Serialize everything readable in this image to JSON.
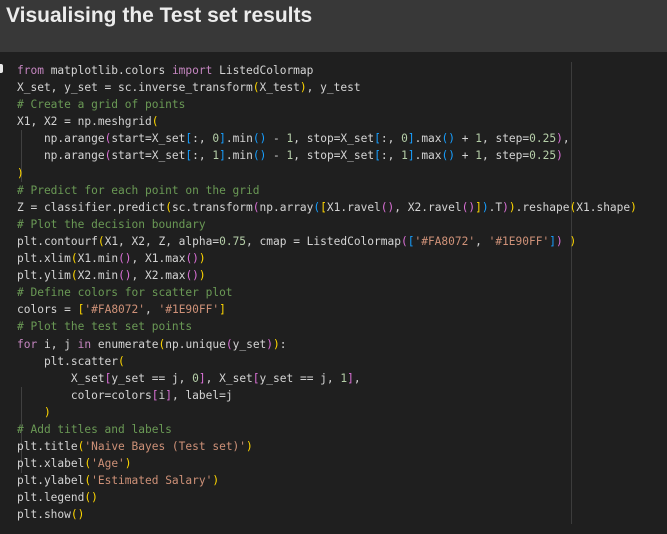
{
  "heading": "Visualising the Test set results",
  "code_lines": [
    [
      {
        "t": "from",
        "c": "kw"
      },
      {
        "t": " matplotlib.colors ",
        "c": "id"
      },
      {
        "t": "import",
        "c": "kw"
      },
      {
        "t": " ListedColormap",
        "c": "id"
      }
    ],
    [
      {
        "t": "X_set, y_set = sc.inverse_transform",
        "c": "id"
      },
      {
        "t": "(",
        "c": "p1"
      },
      {
        "t": "X_test",
        "c": "id"
      },
      {
        "t": ")",
        "c": "p1"
      },
      {
        "t": ", y_test",
        "c": "id"
      }
    ],
    [
      {
        "t": "# Create a grid of points",
        "c": "cm"
      }
    ],
    [
      {
        "t": "X1, X2 = np.meshgrid",
        "c": "id"
      },
      {
        "t": "(",
        "c": "p1"
      }
    ],
    [
      {
        "t": "    np.arange",
        "c": "id"
      },
      {
        "t": "(",
        "c": "p2"
      },
      {
        "t": "start=X_set",
        "c": "id"
      },
      {
        "t": "[",
        "c": "p3"
      },
      {
        "t": ":, ",
        "c": "id"
      },
      {
        "t": "0",
        "c": "nm"
      },
      {
        "t": "]",
        "c": "p3"
      },
      {
        "t": ".min",
        "c": "id"
      },
      {
        "t": "()",
        "c": "p3"
      },
      {
        "t": " - ",
        "c": "id"
      },
      {
        "t": "1",
        "c": "nm"
      },
      {
        "t": ", stop=X_set",
        "c": "id"
      },
      {
        "t": "[",
        "c": "p3"
      },
      {
        "t": ":, ",
        "c": "id"
      },
      {
        "t": "0",
        "c": "nm"
      },
      {
        "t": "]",
        "c": "p3"
      },
      {
        "t": ".max",
        "c": "id"
      },
      {
        "t": "()",
        "c": "p3"
      },
      {
        "t": " + ",
        "c": "id"
      },
      {
        "t": "1",
        "c": "nm"
      },
      {
        "t": ", step=",
        "c": "id"
      },
      {
        "t": "0.25",
        "c": "nm"
      },
      {
        "t": ")",
        "c": "p2"
      },
      {
        "t": ",",
        "c": "id"
      }
    ],
    [
      {
        "t": "    np.arange",
        "c": "id"
      },
      {
        "t": "(",
        "c": "p2"
      },
      {
        "t": "start=X_set",
        "c": "id"
      },
      {
        "t": "[",
        "c": "p3"
      },
      {
        "t": ":, ",
        "c": "id"
      },
      {
        "t": "1",
        "c": "nm"
      },
      {
        "t": "]",
        "c": "p3"
      },
      {
        "t": ".min",
        "c": "id"
      },
      {
        "t": "()",
        "c": "p3"
      },
      {
        "t": " - ",
        "c": "id"
      },
      {
        "t": "1",
        "c": "nm"
      },
      {
        "t": ", stop=X_set",
        "c": "id"
      },
      {
        "t": "[",
        "c": "p3"
      },
      {
        "t": ":, ",
        "c": "id"
      },
      {
        "t": "1",
        "c": "nm"
      },
      {
        "t": "]",
        "c": "p3"
      },
      {
        "t": ".max",
        "c": "id"
      },
      {
        "t": "()",
        "c": "p3"
      },
      {
        "t": " + ",
        "c": "id"
      },
      {
        "t": "1",
        "c": "nm"
      },
      {
        "t": ", step=",
        "c": "id"
      },
      {
        "t": "0.25",
        "c": "nm"
      },
      {
        "t": ")",
        "c": "p2"
      }
    ],
    [
      {
        "t": ")",
        "c": "p1"
      }
    ],
    [
      {
        "t": "# Predict for each point on the grid",
        "c": "cm"
      }
    ],
    [
      {
        "t": "Z = classifier.predict",
        "c": "id"
      },
      {
        "t": "(",
        "c": "p1"
      },
      {
        "t": "sc.transform",
        "c": "id"
      },
      {
        "t": "(",
        "c": "p2"
      },
      {
        "t": "np.array",
        "c": "id"
      },
      {
        "t": "(",
        "c": "p3"
      },
      {
        "t": "[",
        "c": "p1"
      },
      {
        "t": "X1.ravel",
        "c": "id"
      },
      {
        "t": "()",
        "c": "p2"
      },
      {
        "t": ", X2.ravel",
        "c": "id"
      },
      {
        "t": "()",
        "c": "p2"
      },
      {
        "t": "]",
        "c": "p1"
      },
      {
        "t": ")",
        "c": "p3"
      },
      {
        "t": ".T",
        "c": "id"
      },
      {
        "t": ")",
        "c": "p2"
      },
      {
        "t": ")",
        "c": "p1"
      },
      {
        "t": ".reshape",
        "c": "id"
      },
      {
        "t": "(",
        "c": "p1"
      },
      {
        "t": "X1.shape",
        "c": "id"
      },
      {
        "t": ")",
        "c": "p1"
      }
    ],
    [
      {
        "t": "# Plot the decision boundary",
        "c": "cm"
      }
    ],
    [
      {
        "t": "plt.contourf",
        "c": "id"
      },
      {
        "t": "(",
        "c": "p1"
      },
      {
        "t": "X1, X2, Z, alpha=",
        "c": "id"
      },
      {
        "t": "0.75",
        "c": "nm"
      },
      {
        "t": ", cmap = ListedColormap",
        "c": "id"
      },
      {
        "t": "(",
        "c": "p2"
      },
      {
        "t": "[",
        "c": "p3"
      },
      {
        "t": "'#FA8072'",
        "c": "st"
      },
      {
        "t": ", ",
        "c": "id"
      },
      {
        "t": "'#1E90FF'",
        "c": "st"
      },
      {
        "t": "]",
        "c": "p3"
      },
      {
        "t": ")",
        "c": "p2"
      },
      {
        "t": " ",
        "c": "id"
      },
      {
        "t": ")",
        "c": "p1"
      }
    ],
    [
      {
        "t": "plt.xlim",
        "c": "id"
      },
      {
        "t": "(",
        "c": "p1"
      },
      {
        "t": "X1.min",
        "c": "id"
      },
      {
        "t": "()",
        "c": "p2"
      },
      {
        "t": ", X1.max",
        "c": "id"
      },
      {
        "t": "()",
        "c": "p2"
      },
      {
        "t": ")",
        "c": "p1"
      }
    ],
    [
      {
        "t": "plt.ylim",
        "c": "id"
      },
      {
        "t": "(",
        "c": "p1"
      },
      {
        "t": "X2.min",
        "c": "id"
      },
      {
        "t": "()",
        "c": "p2"
      },
      {
        "t": ", X2.max",
        "c": "id"
      },
      {
        "t": "()",
        "c": "p2"
      },
      {
        "t": ")",
        "c": "p1"
      }
    ],
    [
      {
        "t": "# Define colors for scatter plot",
        "c": "cm"
      }
    ],
    [
      {
        "t": "colors = ",
        "c": "id"
      },
      {
        "t": "[",
        "c": "p1"
      },
      {
        "t": "'#FA8072'",
        "c": "st"
      },
      {
        "t": ", ",
        "c": "id"
      },
      {
        "t": "'#1E90FF'",
        "c": "st"
      },
      {
        "t": "]",
        "c": "p1"
      }
    ],
    [
      {
        "t": "# Plot the test set points",
        "c": "cm"
      }
    ],
    [
      {
        "t": "for",
        "c": "kw"
      },
      {
        "t": " i, j ",
        "c": "id"
      },
      {
        "t": "in",
        "c": "kw"
      },
      {
        "t": " enumerate",
        "c": "id"
      },
      {
        "t": "(",
        "c": "p1"
      },
      {
        "t": "np.unique",
        "c": "id"
      },
      {
        "t": "(",
        "c": "p2"
      },
      {
        "t": "y_set",
        "c": "id"
      },
      {
        "t": ")",
        "c": "p2"
      },
      {
        "t": ")",
        "c": "p1"
      },
      {
        "t": ":",
        "c": "id"
      }
    ],
    [
      {
        "t": "    plt.scatter",
        "c": "id"
      },
      {
        "t": "(",
        "c": "p1"
      }
    ],
    [
      {
        "t": "        X_set",
        "c": "id"
      },
      {
        "t": "[",
        "c": "p2"
      },
      {
        "t": "y_set == j, ",
        "c": "id"
      },
      {
        "t": "0",
        "c": "nm"
      },
      {
        "t": "]",
        "c": "p2"
      },
      {
        "t": ", X_set",
        "c": "id"
      },
      {
        "t": "[",
        "c": "p2"
      },
      {
        "t": "y_set == j, ",
        "c": "id"
      },
      {
        "t": "1",
        "c": "nm"
      },
      {
        "t": "]",
        "c": "p2"
      },
      {
        "t": ",",
        "c": "id"
      }
    ],
    [
      {
        "t": "        color=colors",
        "c": "id"
      },
      {
        "t": "[",
        "c": "p2"
      },
      {
        "t": "i",
        "c": "id"
      },
      {
        "t": "]",
        "c": "p2"
      },
      {
        "t": ", label=j",
        "c": "id"
      }
    ],
    [
      {
        "t": "    ",
        "c": "id"
      },
      {
        "t": ")",
        "c": "p1"
      }
    ],
    [
      {
        "t": "# Add titles and labels",
        "c": "cm"
      }
    ],
    [
      {
        "t": "plt.title",
        "c": "id"
      },
      {
        "t": "(",
        "c": "p1"
      },
      {
        "t": "'Naive Bayes (Test set)'",
        "c": "st"
      },
      {
        "t": ")",
        "c": "p1"
      }
    ],
    [
      {
        "t": "plt.xlabel",
        "c": "id"
      },
      {
        "t": "(",
        "c": "p1"
      },
      {
        "t": "'Age'",
        "c": "st"
      },
      {
        "t": ")",
        "c": "p1"
      }
    ],
    [
      {
        "t": "plt.ylabel",
        "c": "id"
      },
      {
        "t": "(",
        "c": "p1"
      },
      {
        "t": "'Estimated Salary'",
        "c": "st"
      },
      {
        "t": ")",
        "c": "p1"
      }
    ],
    [
      {
        "t": "plt.legend",
        "c": "id"
      },
      {
        "t": "()",
        "c": "p1"
      }
    ],
    [
      {
        "t": "plt.show",
        "c": "id"
      },
      {
        "t": "()",
        "c": "p1"
      }
    ]
  ]
}
